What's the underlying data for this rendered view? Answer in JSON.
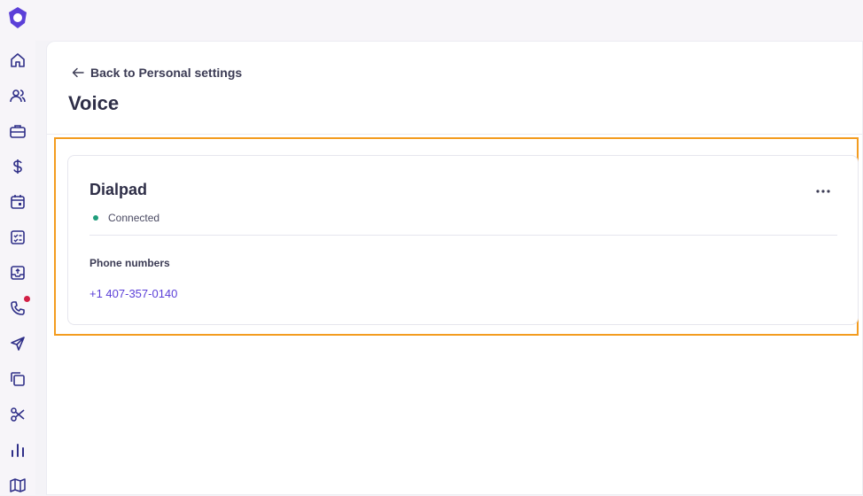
{
  "colors": {
    "accent": "#5b3fd8",
    "connected": "#1f9d7b",
    "notification": "#d21f45",
    "highlight": "#f39c1f"
  },
  "sidebar": {
    "icons": [
      "logo-icon",
      "home-icon",
      "people-icon",
      "briefcase-icon",
      "dollar-icon",
      "calendar-icon",
      "tasks-icon",
      "inbox-upload-icon",
      "phone-icon",
      "send-icon",
      "copy-icon",
      "scissors-icon",
      "bar-chart-icon",
      "map-icon"
    ]
  },
  "header": {
    "back_label": "Back to Personal settings",
    "title": "Voice"
  },
  "card": {
    "title": "Dialpad",
    "status": "Connected",
    "section_label": "Phone numbers",
    "phone_number": "+1 407-357-0140"
  }
}
